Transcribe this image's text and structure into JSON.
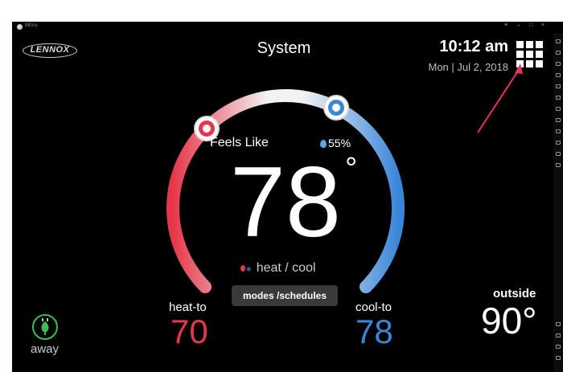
{
  "window": {
    "title": "MEnu"
  },
  "brand": {
    "logo_text": "LENNOX"
  },
  "header": {
    "title": "System",
    "time": "10:12 am",
    "date": "Mon | Jul 2, 2018"
  },
  "thermostat": {
    "feels_like_label": "Feels Like",
    "humidity": "55%",
    "temperature": "78",
    "degree_symbol": "°",
    "mode": "heat / cool",
    "modes_button": "modes /schedules",
    "heat_to_label": "heat-to",
    "heat_to_value": "70",
    "cool_to_label": "cool-to",
    "cool_to_value": "78"
  },
  "outside": {
    "label": "outside",
    "value": "90°"
  },
  "away": {
    "label": "away"
  },
  "colors": {
    "heat": "#e6374a",
    "cool": "#3a86d9",
    "away": "#3cbc55",
    "annotation": "#e8315b"
  }
}
